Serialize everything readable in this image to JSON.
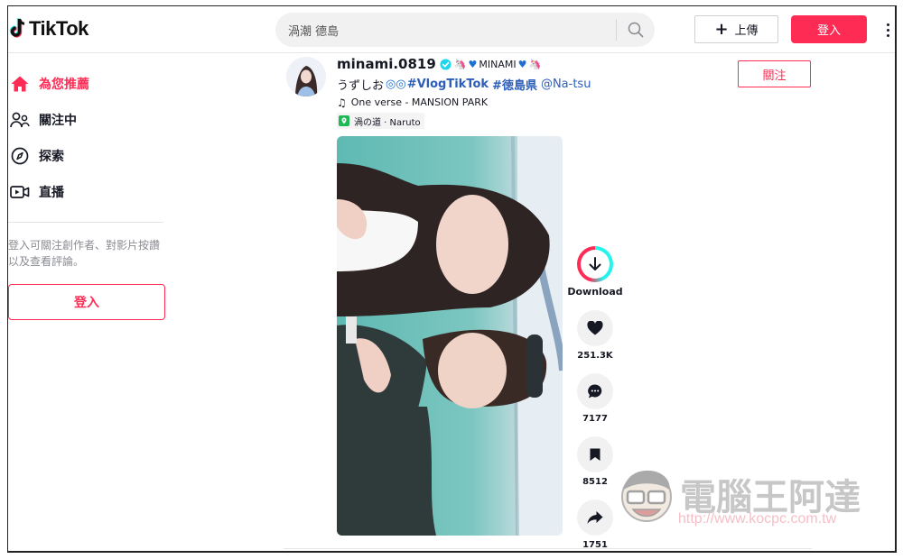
{
  "app": {
    "name": "TikTok"
  },
  "header": {
    "search": {
      "value": "渦潮 德島",
      "placeholder": "搜尋"
    },
    "upload_label": "上傳",
    "login_label": "登入"
  },
  "sidebar": {
    "items": [
      {
        "label": "為您推薦",
        "icon": "home-icon",
        "active": true
      },
      {
        "label": "關注中",
        "icon": "following-icon",
        "active": false
      },
      {
        "label": "探索",
        "icon": "compass-icon",
        "active": false
      },
      {
        "label": "直播",
        "icon": "live-icon",
        "active": false
      }
    ],
    "note": "登入可關注創作者、對影片按讚以及查看評論。",
    "login_label": "登入"
  },
  "post": {
    "username": "minami.0819",
    "verified": true,
    "nickname": "MINAMI",
    "caption_text": "うずしお",
    "hashtags": [
      "#VlogTikTok",
      "#徳島県"
    ],
    "mention": "@Na-tsu",
    "music": "One verse - MANSION PARK",
    "location": "渦の道 · Naruto",
    "follow_label": "關注",
    "actions": {
      "download_label": "Download",
      "likes": "251.3K",
      "comments": "7177",
      "saves": "8512",
      "shares": "1751"
    }
  },
  "watermark": {
    "title": "電腦王阿達",
    "url": "http://www.kocpc.com.tw"
  },
  "colors": {
    "brand": "#fe2c55",
    "cyan": "#25f4ee",
    "link": "#2b5db9"
  }
}
